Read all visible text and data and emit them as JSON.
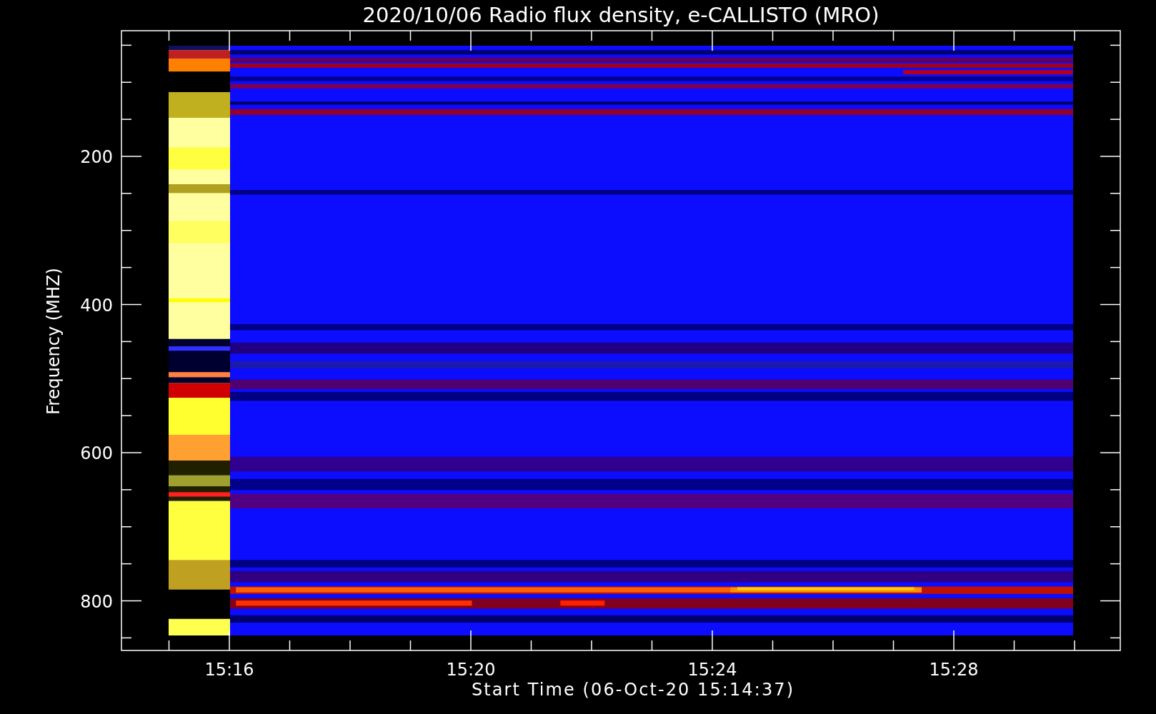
{
  "plot": {
    "title": "2020/10/06  Radio flux density, e-CALLISTO (MRO)",
    "y_axis": {
      "label": "Frequency (MHZ)",
      "ticks": [
        "200",
        "400",
        "600",
        "800"
      ]
    },
    "x_axis": {
      "label": "Start Time (06-Oct-20 15:14:37)",
      "ticks": [
        "15:16",
        "15:20",
        "15:24",
        "15:28"
      ]
    }
  }
}
